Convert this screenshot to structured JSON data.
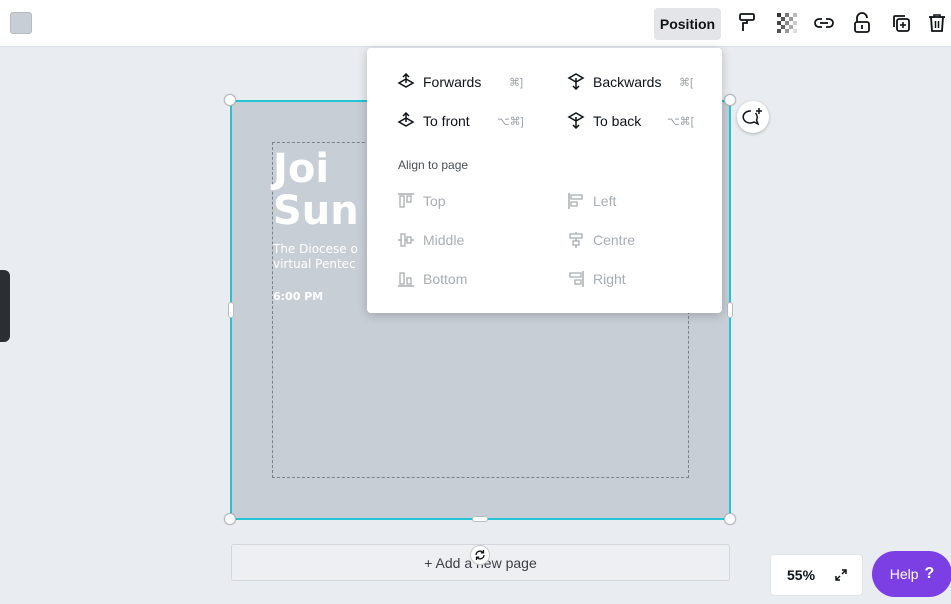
{
  "toolbar": {
    "position_label": "Position",
    "icons": [
      "paint-format-icon",
      "transparency-icon",
      "link-icon",
      "lock-icon",
      "duplicate-icon",
      "delete-icon"
    ]
  },
  "poster": {
    "title_line1": "Joi",
    "title_line2": "Sun",
    "sub_line1": "The Diocese o",
    "sub_line2": "virtual Pentec",
    "time": "6:00 PM"
  },
  "menu": {
    "forwards": "Forwards",
    "forwards_shortcut": "⌘]",
    "backwards": "Backwards",
    "backwards_shortcut": "⌘[",
    "to_front": "To front",
    "to_front_shortcut": "⌥⌘]",
    "to_back": "To back",
    "to_back_shortcut": "⌥⌘[",
    "align_label": "Align to page",
    "top": "Top",
    "left": "Left",
    "middle": "Middle",
    "centre": "Centre",
    "bottom": "Bottom",
    "right": "Right"
  },
  "add_page_label": "+ Add a new page",
  "zoom": "55%",
  "help": {
    "label": "Help",
    "icon": "?"
  },
  "colors": {
    "selection": "#23c4d4",
    "page": "#c8ced6",
    "help_bg": "#7b3fe4"
  }
}
